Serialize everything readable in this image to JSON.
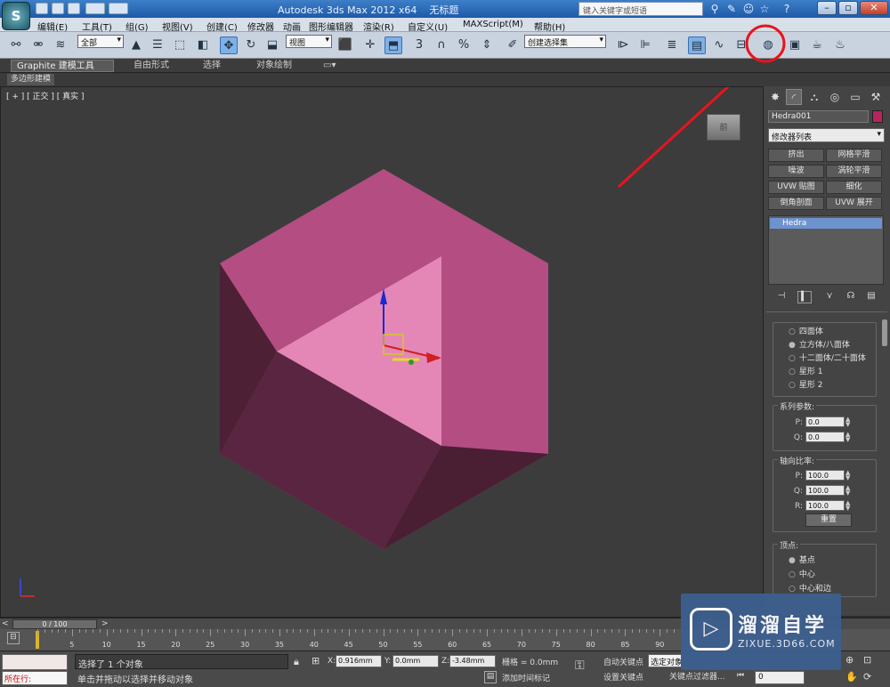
{
  "app": {
    "title": "Autodesk 3ds Max  2012 x64",
    "doc_title": "无标题",
    "logo_letter": "S",
    "search_placeholder": "键入关键字或短语"
  },
  "menu": [
    "编辑(E)",
    "工具(T)",
    "组(G)",
    "视图(V)",
    "创建(C)",
    "修改器",
    "动画",
    "图形编辑器",
    "渲染(R)",
    "自定义(U)",
    "MAXScript(M)",
    "帮助(H)"
  ],
  "toolbar": {
    "selection_filter": "全部",
    "ref_coord": "视图",
    "named_selection": "创建选择集",
    "snap_3": "3",
    "snap_angle": "%"
  },
  "ribbon": {
    "tabs": [
      "Graphite 建模工具",
      "自由形式",
      "选择",
      "对象绘制"
    ],
    "sub": "多边形建模"
  },
  "viewport": {
    "label": "[ + ] [ 正交 ] [ 真实 ]",
    "viewcube_label": "前",
    "object_color": "#b8245d"
  },
  "command_panel": {
    "object_name": "Hedra001",
    "modifier_list": "修改器列表",
    "modifier_buttons": [
      "挤出",
      "网格平滑",
      "噪波",
      "涡轮平滑",
      "UVW 贴图",
      "细化",
      "倒角剖面",
      "UVW 展开"
    ],
    "stack_items": [
      "Hedra"
    ],
    "family_options": [
      "四面体",
      "立方体/八面体",
      "十二面体/二十面体",
      "星形 1",
      "星形 2"
    ],
    "family_selected": 1,
    "family_params_label": "系列参数:",
    "P_label": "P:",
    "P_value": "0.0",
    "Q_label": "Q:",
    "Q_value": "0.0",
    "axis_ratio_label": "轴向比率:",
    "axis_P_label": "P:",
    "axis_P": "100.0",
    "axis_Q_label": "Q:",
    "axis_Q": "100.0",
    "axis_R_label": "R:",
    "axis_R": "100.0",
    "reset_label": "重置",
    "vertex_label": "顶点:",
    "vertex_options": [
      "基点",
      "中心",
      "中心和边"
    ],
    "vertex_selected": 0
  },
  "time": {
    "slider_label": "0 / 100",
    "ticks": [
      "5",
      "10",
      "15",
      "20",
      "25",
      "30",
      "35",
      "40",
      "45",
      "50",
      "55",
      "60",
      "65",
      "70",
      "75",
      "80",
      "85",
      "90"
    ]
  },
  "status": {
    "running_label": "所在行:",
    "selection_info": "选择了 1 个对象",
    "prompt": "单击并拖动以选择并移动对象",
    "x_label": "X:",
    "x_value": "0.916mm",
    "y_label": "Y:",
    "y_value": "0.0mm",
    "z_label": "Z:",
    "z_value": "-3.48mm",
    "grid": "栅格 = 0.0mm",
    "add_time_tag": "添加时间标记",
    "auto_key": "自动关键点",
    "selected_set": "选定对象",
    "set_key": "设置关键点",
    "key_filters": "关键点过滤器...",
    "frame": "0"
  },
  "watermark": {
    "name": "溜溜自学",
    "url": "ZIXUE.3D66.COM"
  },
  "colors": {
    "annotation": "#e8141d",
    "object_top": "#b34d82",
    "object_light": "#e37fb3",
    "object_dark": "#5a2540"
  }
}
